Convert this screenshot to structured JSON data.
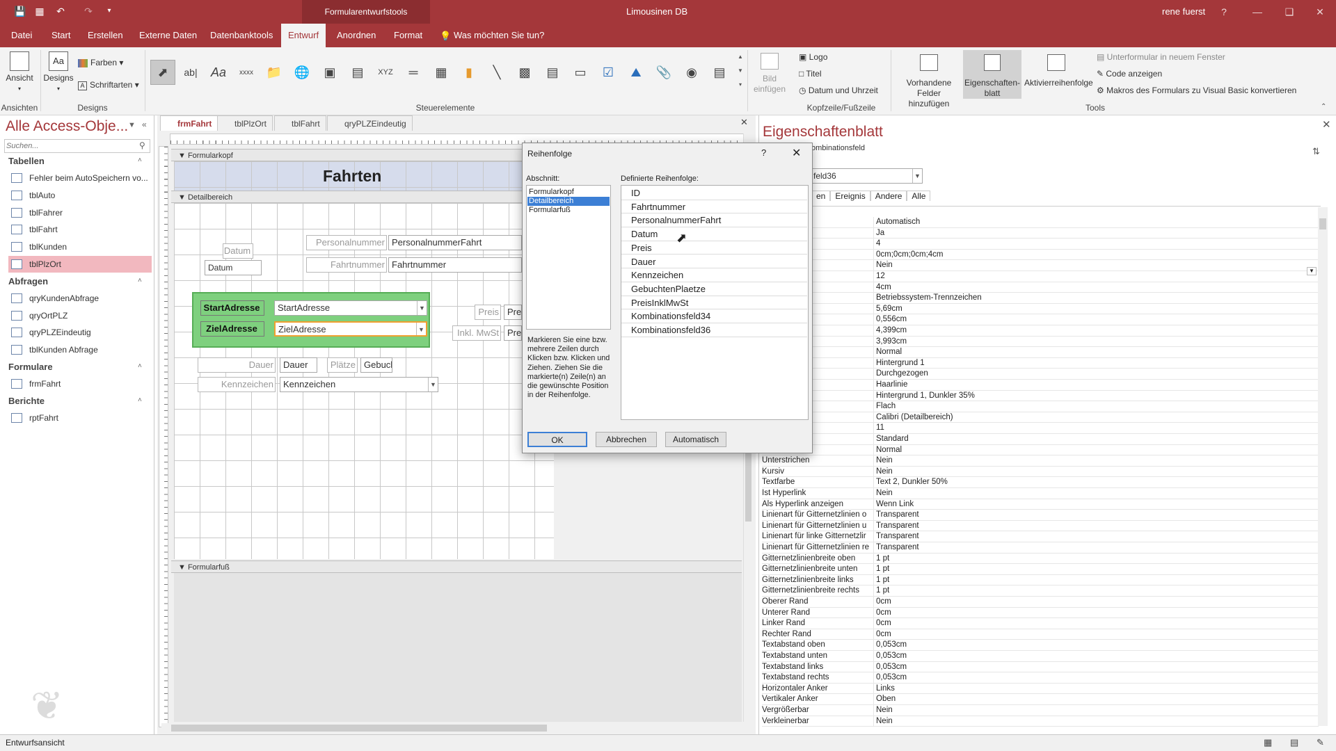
{
  "titlebar": {
    "context_title": "Formularentwurfstools",
    "app_title": "Limousinen DB",
    "user": "rene fuerst",
    "help": "?"
  },
  "tabs": {
    "datei": "Datei",
    "start": "Start",
    "erstellen": "Erstellen",
    "externe_daten": "Externe Daten",
    "datenbanktools": "Datenbanktools",
    "entwurf": "Entwurf",
    "anordnen": "Anordnen",
    "format": "Format",
    "tell_me": "Was möchten Sie tun?"
  },
  "ribbon": {
    "ansicht": "Ansicht",
    "designs": "Designs",
    "farben": "Farben",
    "schriftarten": "Schriftarten",
    "group_ansichten": "Ansichten",
    "group_designs": "Designs",
    "group_steuerelemente": "Steuerelemente",
    "bild_einfuegen_1": "Bild",
    "bild_einfuegen_2": "einfügen",
    "logo": "Logo",
    "titel": "Titel",
    "datum_uhrzeit": "Datum und Uhrzeit",
    "group_kopf": "Kopfzeile/Fußzeile",
    "felder_1": "Vorhandene",
    "felder_2": "Felder hinzufügen",
    "eig_1": "Eigenschaften-",
    "eig_2": "blatt",
    "aktiv_1": "Aktivierreihenfolge",
    "unterformular": "Unterformular in neuem Fenster",
    "code": "Code anzeigen",
    "makros": "Makros des Formulars zu Visual Basic konvertieren",
    "group_tools": "Tools",
    "control_label": "xxxx",
    "control_text": "Aa",
    "control_xyz": "XYZ"
  },
  "nav": {
    "header": "Alle Access-Obje...",
    "search_placeholder": "Suchen...",
    "sections": [
      {
        "title": "Tabellen",
        "items": [
          "Fehler beim AutoSpeichern vo...",
          "tblAuto",
          "tblFahrer",
          "tblFahrt",
          "tblKunden",
          "tblPlzOrt"
        ]
      },
      {
        "title": "Abfragen",
        "items": [
          "qryKundenAbfrage",
          "qryOrtPLZ",
          "qryPLZEindeutig",
          "tblKunden Abfrage"
        ]
      },
      {
        "title": "Formulare",
        "items": [
          "frmFahrt"
        ]
      },
      {
        "title": "Berichte",
        "items": [
          "rptFahrt"
        ]
      }
    ],
    "selected": "tblPlzOrt"
  },
  "doc_tabs": [
    "frmFahrt",
    "tblPlzOrt",
    "tblFahrt",
    "qryPLZEindeutig"
  ],
  "form": {
    "header_section": "Formularkopf",
    "detail_section": "Detailbereich",
    "footer_section": "Formularfuß",
    "title": "Fahrten",
    "labels": {
      "datum": "Datum",
      "personalnummer": "Personalnummer",
      "fahrtnummer": "Fahrtnummer",
      "startadresse": "StartAdresse",
      "zieladresse": "ZielAdresse",
      "preis": "Preis",
      "inkl_mwst": "Inkl. MwSt",
      "dauer": "Dauer",
      "plaetze": "Plätze",
      "kennzeichen": "Kennzeichen"
    },
    "fields": {
      "datum": "Datum",
      "personalnummer": "PersonalnummerFahrt",
      "fahrtnummer": "Fahrtnummer",
      "startadresse": "StartAdresse",
      "zieladresse": "ZielAdresse",
      "preis": "Prei",
      "preis_inkl": "Prei",
      "dauer": "Dauer",
      "gebucht": "Gebucl",
      "kennzeichen": "Kennzeichen"
    }
  },
  "dialog": {
    "title": "Reihenfolge",
    "help": "?",
    "abschnitt_label": "Abschnitt:",
    "abschnitte": [
      "Formularkopf",
      "Detailbereich",
      "Formularfuß"
    ],
    "selected_abschnitt": "Detailbereich",
    "definiert_label": "Definierte Reihenfolge:",
    "order": [
      "ID",
      "Fahrtnummer",
      "PersonalnummerFahrt",
      "Datum",
      "Preis",
      "Dauer",
      "Kennzeichen",
      "GebuchtenPlaetze",
      "PreisInklMwSt",
      "Kombinationsfeld34",
      "Kombinationsfeld36"
    ],
    "hint": "Markieren Sie eine bzw. mehrere Zeilen durch Klicken bzw. Klicken und Ziehen. Ziehen Sie die markierte(n) Zeile(n) an die gewünschte Position in der Reihenfolge.",
    "ok": "OK",
    "abbrechen": "Abbrechen",
    "automatisch": "Automatisch"
  },
  "props": {
    "title": "Eigenschaftenblatt",
    "subtitle": "ombinationsfeld",
    "selector_value": "feld36",
    "tabs": [
      "en",
      "Ereignis",
      "Andere",
      "Alle"
    ],
    "rows": [
      [
        "anzeige",
        "Automatisch"
      ],
      [
        "",
        "Ja"
      ],
      [
        "",
        "4"
      ],
      [
        "n",
        "0cm;0cm;0cm;4cm"
      ],
      [
        "hriften",
        "Nein"
      ],
      [
        "",
        "12"
      ],
      [
        "",
        "4cm"
      ],
      [
        "",
        "Betriebssystem-Trennzeichen"
      ],
      [
        "",
        "5,69cm"
      ],
      [
        "",
        "0,556cm"
      ],
      [
        "",
        "4,399cm"
      ],
      [
        "",
        "3,993cm"
      ],
      [
        "t",
        "Normal"
      ],
      [
        "rbe",
        "Hintergrund 1"
      ],
      [
        "",
        "Durchgezogen"
      ],
      [
        "",
        "Haarlinie"
      ],
      [
        "",
        "Hintergrund 1, Dunkler 35%"
      ],
      [
        "",
        "Flach"
      ],
      [
        "",
        "Calibri (Detailbereich)"
      ],
      [
        "",
        "11"
      ],
      [
        "g",
        "Standard"
      ],
      [
        "",
        "Normal"
      ],
      [
        "Unterstrichen",
        "Nein"
      ],
      [
        "Kursiv",
        "Nein"
      ],
      [
        "Textfarbe",
        "Text 2, Dunkler 50%"
      ],
      [
        "Ist Hyperlink",
        "Nein"
      ],
      [
        "Als Hyperlink anzeigen",
        "Wenn Link"
      ],
      [
        "Linienart für Gitternetzlinien o",
        "Transparent"
      ],
      [
        "Linienart für Gitternetzlinien u",
        "Transparent"
      ],
      [
        "Linienart für linke Gitternetzlir",
        "Transparent"
      ],
      [
        "Linienart für Gitternetzlinien re",
        "Transparent"
      ],
      [
        "Gitternetzlinienbreite oben",
        "1 pt"
      ],
      [
        "Gitternetzlinienbreite unten",
        "1 pt"
      ],
      [
        "Gitternetzlinienbreite links",
        "1 pt"
      ],
      [
        "Gitternetzlinienbreite rechts",
        "1 pt"
      ],
      [
        "Oberer Rand",
        "0cm"
      ],
      [
        "Unterer Rand",
        "0cm"
      ],
      [
        "Linker Rand",
        "0cm"
      ],
      [
        "Rechter Rand",
        "0cm"
      ],
      [
        "Textabstand oben",
        "0,053cm"
      ],
      [
        "Textabstand unten",
        "0,053cm"
      ],
      [
        "Textabstand links",
        "0,053cm"
      ],
      [
        "Textabstand rechts",
        "0,053cm"
      ],
      [
        "Horizontaler Anker",
        "Links"
      ],
      [
        "Vertikaler Anker",
        "Oben"
      ],
      [
        "Vergrößerbar",
        "Nein"
      ],
      [
        "Verkleinerbar",
        "Nein"
      ]
    ]
  },
  "status": {
    "text": "Entwurfsansicht"
  },
  "colors": {
    "accent": "#a4373a",
    "selection": "#f2b8bf",
    "group_fill": "#7ed07e"
  }
}
